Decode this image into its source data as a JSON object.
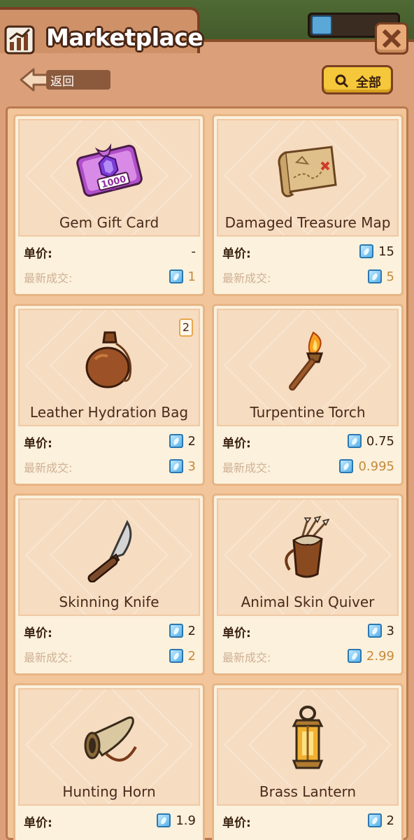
{
  "header": {
    "title": "Marketplace",
    "back_label": "返回",
    "filter_label": "全部"
  },
  "labels": {
    "unit_price": "单价:",
    "last_trade": "最新成交:"
  },
  "items": [
    {
      "name": "Gem Gift Card",
      "unit_price": "-",
      "last_trade": "1",
      "icon": "gem-gift-card-icon"
    },
    {
      "name": "Damaged Treasure Map",
      "unit_price": "15",
      "last_trade": "5",
      "icon": "treasure-map-icon"
    },
    {
      "name": "Leather Hydration Bag",
      "unit_price": "2",
      "last_trade": "3",
      "icon": "leather-bag-icon",
      "count": "2"
    },
    {
      "name": "Turpentine Torch",
      "unit_price": "0.75",
      "last_trade": "0.995",
      "icon": "torch-icon"
    },
    {
      "name": "Skinning Knife",
      "unit_price": "2",
      "last_trade": "2",
      "icon": "knife-icon"
    },
    {
      "name": "Animal Skin Quiver",
      "unit_price": "3",
      "last_trade": "2.99",
      "icon": "quiver-icon"
    },
    {
      "name": "Hunting Horn",
      "unit_price": "1.9",
      "icon": "horn-icon"
    },
    {
      "name": "Brass Lantern",
      "unit_price": "2",
      "icon": "lantern-icon"
    }
  ],
  "colors": {
    "frame": "#dba07a",
    "card": "#fbf1dd",
    "accent_yellow": "#f5c73a",
    "last_trade_value": "#c58a3c"
  }
}
